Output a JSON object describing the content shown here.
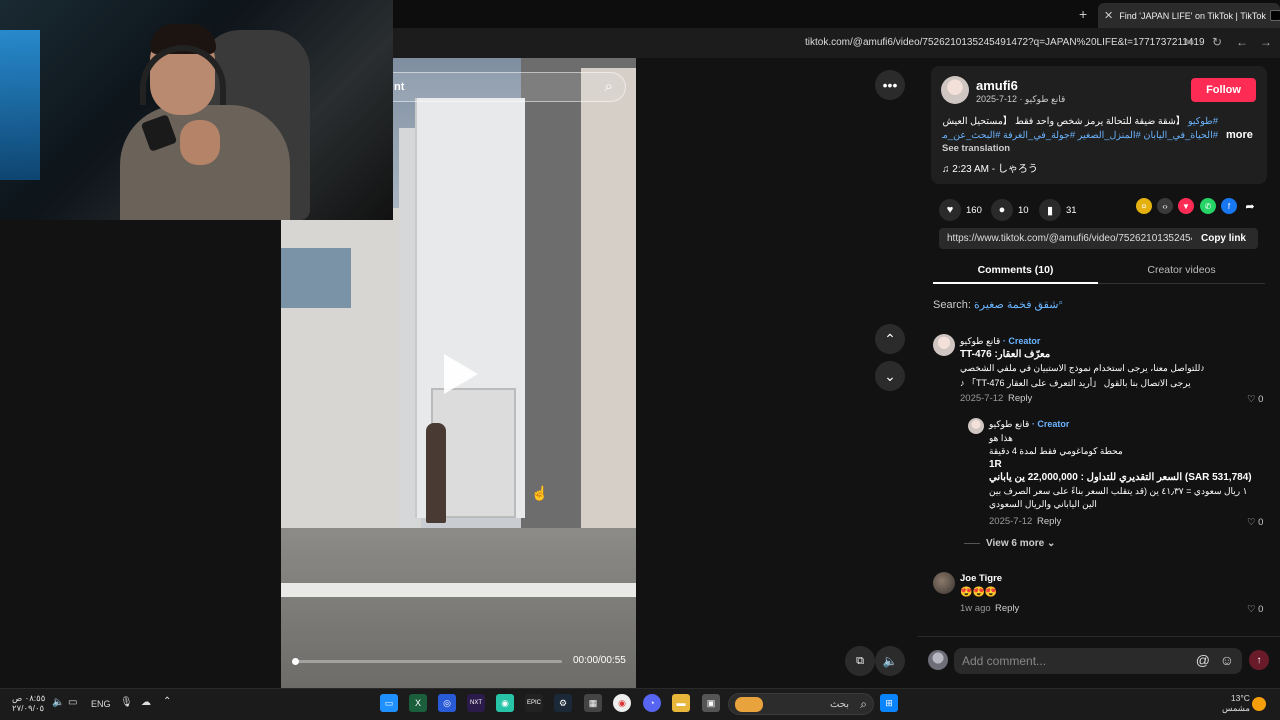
{
  "browser": {
    "new_tab_icon": "+",
    "tab_close": "✕",
    "tab_title": "Find 'JAPAN LIFE' on TikTok | TikTok",
    "url": "tiktok.com/@amufi6/video/7526210135245491472?q=JAPAN%20LIFE&t=1771737211419"
  },
  "video": {
    "search_text": "nt",
    "time": "00:00/00:55",
    "progress": 0
  },
  "post": {
    "username": "amufi6",
    "subline": "2025-7-12 · قانع طوكيو",
    "follow_label": "Follow",
    "desc_line1_tag": "#طوكيو",
    "desc_line1": "【شقة ضيقة للتحالة يرمز شخص واحد فقط 【مستحيل العيش بهذه التحافة...؟",
    "desc_line2": "#الحياة_في_اليابان #المنزل_الصغير #جولة_في_الغرفة #البحث_عن_منزل...",
    "more_label": "more",
    "see_translation": "See translation",
    "music": "♫  2:23 AM - しゃろう",
    "likes": "160",
    "comments": "10",
    "saves": "31",
    "share_link": "https://www.tiktok.com/@amufi6/video/7526210135245491472",
    "copy_link": "Copy link"
  },
  "tabs": {
    "comments": "Comments (10)",
    "creator_videos": "Creator videos"
  },
  "search": {
    "label": "Search:",
    "query": "شقق فخمة صغيرة"
  },
  "comments": [
    {
      "author": "قانع طوكيو",
      "badge": "· Creator",
      "lines": [
        "TT-476 :معرّف العقار",
        "للتواصل معنا، يرجى استخدام نموذج الاستبيان في ملفي الشخصي♪",
        "♪ 「TT-476 يرجى الاتصال بنا بالقول 「أريد التعرف على العقار"
      ],
      "date": "2025-7-12",
      "reply": "Reply",
      "likes": "0"
    },
    {
      "author": "قانع طوكيو",
      "badge": "· Creator",
      "lines": [
        "هذا هو",
        "محطة كوماغومي فقط لمدة 4 دقيقة",
        "1R",
        "السعر التقديري للتداول :  22,000,000 ين ياباني (SAR 531,784)",
        "١ ريال سعودي = ٤١٫٣٧ ين (قد يتقلب السعر بناءً على سعر الصرف بين",
        "الين الياباني والريال السعودي"
      ],
      "date": "2025-7-12",
      "reply": "Reply",
      "likes": "0"
    },
    {
      "author": "Joe Tigre",
      "lines": [
        "😍😍😍"
      ],
      "date": "1w ago",
      "reply": "Reply",
      "likes": "0"
    }
  ],
  "view_more": "View 6 more",
  "add_comment": {
    "placeholder": "Add comment...",
    "at": "@",
    "emoji": "☺"
  },
  "taskbar": {
    "time": "٠٨:٥٥ ص",
    "date": "٢٧/٠٩/٠٥",
    "lang": "ENG",
    "search_placeholder": "بحث",
    "weather_temp": "13°C",
    "weather_desc": "مشمس"
  },
  "colors": {
    "accent": "#fe2c55",
    "link": "#6ab4ff"
  }
}
